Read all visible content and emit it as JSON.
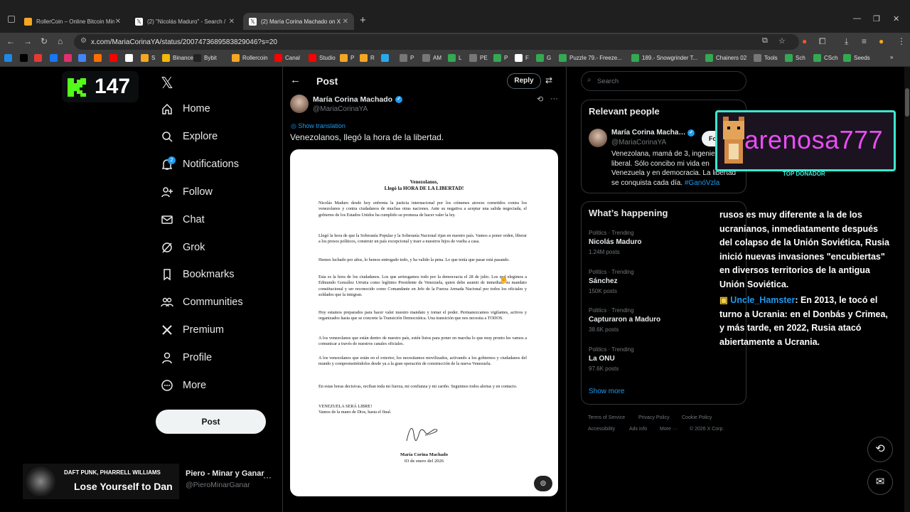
{
  "tabs": [
    {
      "title": "RollerCoin – Online Bitcoin Mini",
      "color": "#f5a623"
    },
    {
      "title": "(2) \"Nicolás Maduro\" - Search /",
      "color": "#ffffff"
    },
    {
      "title": "(2) María Corina Machado on X",
      "color": "#ffffff"
    }
  ],
  "address": {
    "url": "x.com/MariaCorinaYA/status/2007473689583829046?s=20"
  },
  "bookmarks": [
    {
      "label": "",
      "color": "#1e88e5"
    },
    {
      "label": "",
      "color": "#000000"
    },
    {
      "label": "",
      "color": "#e53935"
    },
    {
      "label": "",
      "color": "#1877f2"
    },
    {
      "label": "",
      "color": "#e1306c"
    },
    {
      "label": "",
      "color": "#4285f4"
    },
    {
      "label": "",
      "color": "#ff6f00"
    },
    {
      "label": "",
      "color": "#ff0000"
    },
    {
      "label": "",
      "color": "#ffffff"
    },
    {
      "label": "S",
      "color": "#f5a623"
    },
    {
      "label": "Binance",
      "color": "#f0b90b"
    },
    {
      "label": "Bybit",
      "color": "#222222"
    },
    {
      "label": "Rollercoin",
      "color": "#f5a623"
    },
    {
      "label": "Canal",
      "color": "#ff0000"
    },
    {
      "label": "Studio",
      "color": "#ff0000"
    },
    {
      "label": "P",
      "color": "#f5a623"
    },
    {
      "label": "R",
      "color": "#f5a623"
    },
    {
      "label": "",
      "color": "#29a9ea"
    },
    {
      "label": "P",
      "color": "#777777"
    },
    {
      "label": "AM",
      "color": "#777777"
    },
    {
      "label": "L",
      "color": "#34a853"
    },
    {
      "label": "PE",
      "color": "#777777"
    },
    {
      "label": "P",
      "color": "#34a853"
    },
    {
      "label": "F",
      "color": "#ffffff"
    },
    {
      "label": "G",
      "color": "#34a853"
    },
    {
      "label": "Puzzle 79.- Freeze...",
      "color": "#34a853"
    },
    {
      "label": "189.- Snowgrinder T...",
      "color": "#34a853"
    },
    {
      "label": "Chainers 02",
      "color": "#34a853"
    },
    {
      "label": "Tools",
      "color": "#777777"
    },
    {
      "label": "Sch",
      "color": "#34a853"
    },
    {
      "label": "CSch",
      "color": "#34a853"
    },
    {
      "label": "Seeds",
      "color": "#34a853"
    }
  ],
  "kick": {
    "count": "147"
  },
  "nav": {
    "items": [
      "Home",
      "Explore",
      "Notifications",
      "Follow",
      "Chat",
      "Grok",
      "Bookmarks",
      "Communities",
      "Premium",
      "Profile",
      "More"
    ],
    "notif_badge": "2",
    "post_label": "Post"
  },
  "account": {
    "name": "Piero - Minar y Ganar",
    "handle": "@PieroMinarGanar"
  },
  "music": {
    "artist": "DAFT PUNK, PHARRELL WILLIAMS",
    "song": "Lose Yourself to Dan"
  },
  "post": {
    "header": "Post",
    "reply_label": "Reply",
    "author": "María Corina Machado",
    "handle": "@MariaCorinaYA",
    "show_translation": "Show translation",
    "text": "Venezolanos, llegó la hora de la libertad."
  },
  "document": {
    "title1": "Venezolanos,",
    "title2": "Llegó la HORA DE LA LIBERTAD!",
    "paragraphs": [
      "Nicolás Maduro desde hoy enfrenta la justicia internacional por los crímenes atroces cometidos contra los venezolanos y contra ciudadanos de muchas otras naciones. Ante su negativa a aceptar una salida negociada, el gobierno de los Estados Unidos ha cumplido su promesa de hacer valer la ley.",
      "Llegó la hora de que la Soberanía Popular y la Soberanía Nacional rijan en nuestro país. Vamos a poner orden, liberar a los presos políticos, construir un país excepcional y traer a nuestros hijos de vuelta a casa.",
      "Hemos luchado por años, lo hemos entregado todo, y ha valido la pena. Lo que tenía que pasar está pasando.",
      "Esta es la hora de los ciudadanos. Los que arriesgamos todo por la democracia el 28 de julio. Los que elegimos a Edmundo González Urrutia como legítimo Presidente de Venezuela, quien debe asumir de inmediato su mandato constitucional y ser reconocido como Comandante en Jefe de la Fuerza Armada Nacional por todos los oficiales y soldados que la integran.",
      "Hoy estamos preparados para hacer valer nuestro mandato y tomar el poder. Permanezcamos vigilantes, activos y organizados hasta que se concrete la Transición Democrática. Una transición que nos necesita a TODOS.",
      "A los venezolanos que están dentro de nuestro país, estén listos para poner en marcha lo que muy pronto les vamos a comunicar a través de nuestros canales oficiales.",
      "A los venezolanos que están en el exterior, los necesitamos movilizados, activando a los gobiernos y ciudadanos del mundo y comprometiéndolos desde ya a la gran operación de construcción de la nueva Venezuela.",
      "En estas horas decisivas, reciban toda mi fuerza, mi confianza y mi cariño. Seguimos todos alertas y en contacto.",
      "VENEZUELA SERÁ LIBRE!\nVamos de la mano de Dios, hasta el final."
    ],
    "signer": "María Corina Machado",
    "date": "03 de enero del 2026"
  },
  "right": {
    "search_placeholder": "Search",
    "relevant_title": "Relevant people",
    "person_name": "María Corina Macha…",
    "person_handle": "@MariaCorinaYA",
    "bio": "Venezolana, mamá de 3, ingeniera, liberal. Sólo concibo mi vida en Venezuela y en democracia. La libertad se conquista cada día.",
    "bio_hashtag": "#GanóVzla",
    "follow_label": "Fo",
    "happening_title": "What’s happening",
    "trends": [
      {
        "kicker": "Politics · Trending",
        "name": "Nicolás Maduro",
        "count": "1.24M posts"
      },
      {
        "kicker": "Politics · Trending",
        "name": "Sánchez",
        "count": "150K posts"
      },
      {
        "kicker": "Politics · Trending",
        "name": "Capturaron a Maduro",
        "count": "38.6K posts"
      },
      {
        "kicker": "Politics · Trending",
        "name": "La ONU",
        "count": "97.6K posts"
      }
    ],
    "show_more": "Show more",
    "footer": [
      "Terms of Service",
      "Privacy Policy",
      "Cookie Policy",
      "Accessibility",
      "Ads info",
      "More ···",
      "© 2026 X Corp."
    ]
  },
  "overlay": {
    "donor_name": "arenosa777",
    "donor_label": "TOP DONADOR",
    "chat1": "rusos es muy diferente a la de los ucranianos, inmediatamente después del colapso de la Unión Soviética, Rusia inició nuevas invasiones \"encubiertas\" en diversos territorios de la antigua Unión Soviética.",
    "chat2_user": "Uncle_Hamster",
    "chat2_text": ": En 2013, le tocó el turno a Ucrania: en el Donbás y Crimea, y más tarde, en 2022, Rusia atacó abiertamente a Ucrania."
  },
  "colors": {
    "accent": "#1d9bf0",
    "kick_green": "#53fc18",
    "donor_pink": "#e84df3",
    "donor_border": "#3be8d0"
  }
}
